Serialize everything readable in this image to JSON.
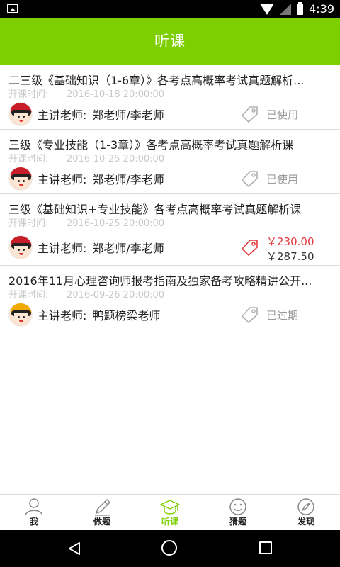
{
  "status_bar": {
    "time": "4:39"
  },
  "header": {
    "title": "听课"
  },
  "labels": {
    "time_label": "开课时间:",
    "teacher_label": "主讲老师:"
  },
  "courses": [
    {
      "title": "二三级《基础知识（1-6章）》各考点高概率考试真题解析...",
      "time": "2016-10-18 20:00:00",
      "teacher": "郑老师/李老师",
      "status": "已使用",
      "avatar": "red-cap"
    },
    {
      "title": "三级《专业技能（1-3章）》各考点高概率考试真题解析课",
      "time": "2016-10-25 20:00:00",
      "teacher": "郑老师/李老师",
      "status": "已使用",
      "avatar": "red-cap"
    },
    {
      "title": "三级《基础知识+专业技能》各考点高概率考试真题解析课",
      "time": "2016-10-25 20:00:00",
      "teacher": "郑老师/李老师",
      "price_now": "￥230.00",
      "price_old": "￥287.50",
      "avatar": "red-cap"
    },
    {
      "title": "2016年11月心理咨询师报考指南及独家备考攻略精讲公开...",
      "time": "2016-09-26 20:00:00",
      "teacher": "鸭题榜梁老师",
      "status": "已过期",
      "avatar": "yellow-cap"
    }
  ],
  "tabs": [
    {
      "label": "我",
      "icon": "person-icon",
      "active": false
    },
    {
      "label": "做题",
      "icon": "pencil-icon",
      "active": false
    },
    {
      "label": "听课",
      "icon": "graduation-cap-icon",
      "active": true
    },
    {
      "label": "猜题",
      "icon": "smiley-icon",
      "active": false
    },
    {
      "label": "发现",
      "icon": "compass-icon",
      "active": false
    }
  ],
  "colors": {
    "accent": "#7dcf00",
    "price": "#e2393e",
    "muted": "#9a9a9a"
  }
}
